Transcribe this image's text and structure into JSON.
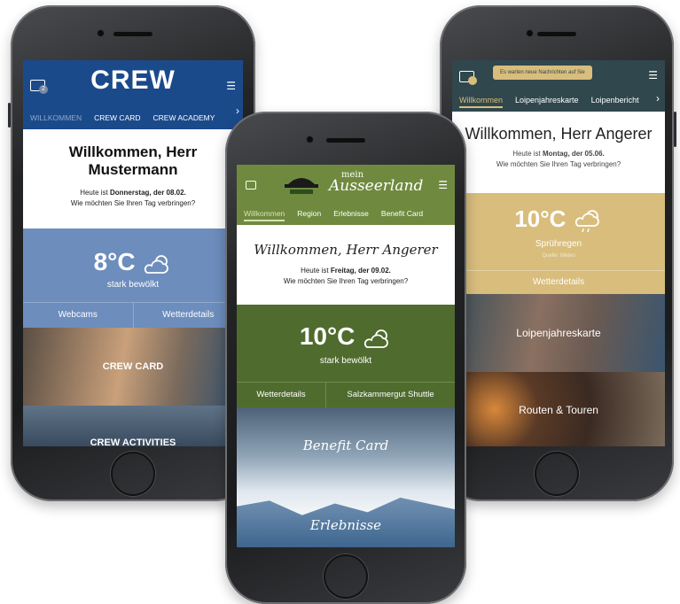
{
  "crew": {
    "logo": "CREW",
    "badge": "2",
    "tabs": [
      "WILLKOMMEN",
      "CREW CARD",
      "CREW ACADEMY"
    ],
    "welcome_title": "Willkommen, Herr Mustermann",
    "date_prefix": "Heute ist ",
    "date_bold": "Donnerstag, der 08.02.",
    "question": "Wie möchten Sie Ihren Tag verbringen?",
    "temp": "8°C",
    "weather_desc": "stark bewölkt",
    "btn_webcams": "Webcams",
    "btn_wetterdetails": "Wetterdetails",
    "card_label": "CREW CARD",
    "activities_label": "CREW ACTIVITIES"
  },
  "loipen": {
    "toast": "Es warten neue Nachrichten auf Sie",
    "tabs": [
      "Willkommen",
      "Loipenjahreskarte",
      "Loipenbericht"
    ],
    "welcome_title": "Willkommen, Herr Angerer",
    "date_prefix": "Heute ist ",
    "date_bold": "Montag, der 05.06.",
    "question": "Wie möchten Sie Ihren Tag verbringen?",
    "temp": "10°C",
    "weather_desc": "Sprühregen",
    "source": "Quelle: Meteo",
    "btn_wetterdetails": "Wetterdetails",
    "card_label": "Loipenjahreskarte",
    "routes_label": "Routen & Touren"
  },
  "ausseerland": {
    "logo_mein": "mein",
    "logo_name": "Ausseerland",
    "tabs": [
      "Willkommen",
      "Region",
      "Erlebnisse",
      "Benefit Card"
    ],
    "welcome_title": "Willkommen, Herr Angerer",
    "date_prefix": "Heute ist ",
    "date_bold": "Freitag, der 09.02.",
    "question": "Wie möchten Sie Ihren Tag verbringen?",
    "temp": "10°C",
    "weather_desc": "stark bewölkt",
    "btn_wetterdetails": "Wetterdetails",
    "btn_shuttle": "Salzkammergut Shuttle",
    "benefit_label": "Benefit Card",
    "erlebnisse_label": "Erlebnisse"
  },
  "colors": {
    "crew_blue": "#1b4a8b",
    "crew_weather": "#6d8dbd",
    "loipen_dark": "#2f474d",
    "loipen_gold": "#d8bd7c",
    "ausseer_green": "#6f8a3f",
    "ausseer_dark_green": "#4f6b2e"
  }
}
